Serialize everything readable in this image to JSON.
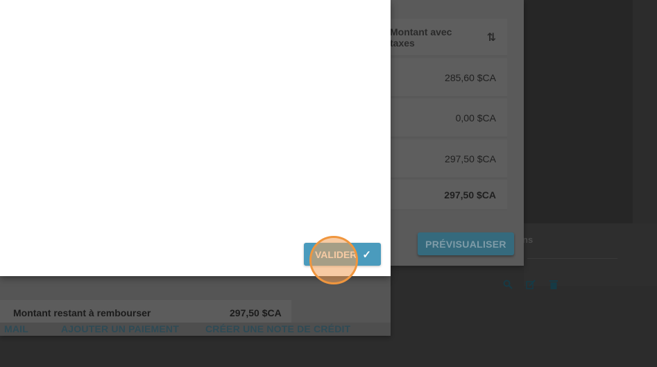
{
  "background": {
    "fragment_text": "ns",
    "icons": [
      "search-icon",
      "edit-icon",
      "delete-icon"
    ]
  },
  "invoice_table": {
    "header": {
      "label": "Montant avec taxes",
      "sort_icon": "⇅"
    },
    "rows": [
      "285,60 $CA",
      "0,00 $CA",
      "297,50 $CA",
      "297,50 $CA"
    ],
    "preview_label": "PRÉVISUALISER"
  },
  "summary": {
    "remaining_label": "Montant restant à rembourser",
    "remaining_value": "297,50 $CA"
  },
  "actions": {
    "mail": "MAIL",
    "add_payment": "AJOUTER UN PAIEMENT",
    "credit_note": "CRÉER UNE NOTE DE CRÉDIT"
  },
  "modal": {
    "validate_label": "VALIDER",
    "validate_icon": "✓"
  },
  "colors": {
    "primary": "#4a9bbd",
    "click_indicator": "#f0963e"
  }
}
